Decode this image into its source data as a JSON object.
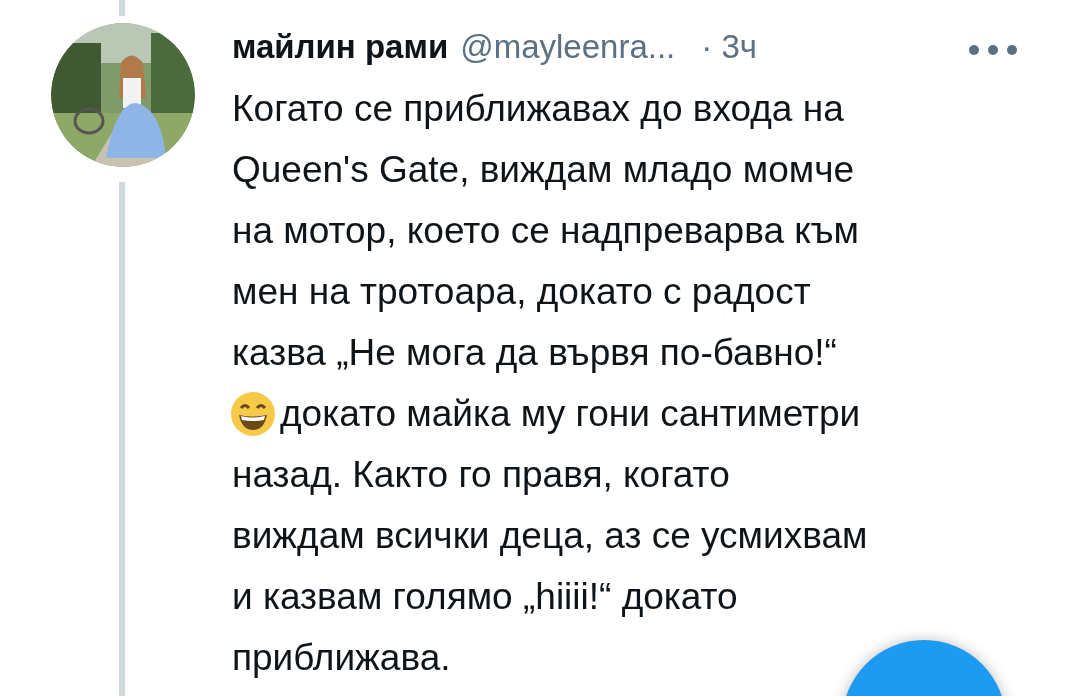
{
  "tweet": {
    "author_name": "майлин рами",
    "handle": "@mayleenra...",
    "time": "· 3ч",
    "lines": [
      {
        "kind": "text",
        "text": "Когато се приближавах до входа на"
      },
      {
        "kind": "text",
        "text": "Queen's Gate, виждам младо момче"
      },
      {
        "kind": "text",
        "text": "на мотор, което се надпреварва към"
      },
      {
        "kind": "text",
        "text": "мен на тротоара, докато с радост"
      },
      {
        "kind": "text",
        "text": "казва „Не мога да вървя по-бавно!“"
      },
      {
        "kind": "emoji",
        "text": "докато майка му гони сантиметри"
      },
      {
        "kind": "text",
        "text": "назад. Както го правя, когато"
      },
      {
        "kind": "text",
        "text": "виждам всички деца, аз се усмихвам"
      },
      {
        "kind": "text",
        "text": "и казвам голямо „hiiii!“ докато"
      },
      {
        "kind": "text",
        "text": "приближава."
      }
    ]
  }
}
